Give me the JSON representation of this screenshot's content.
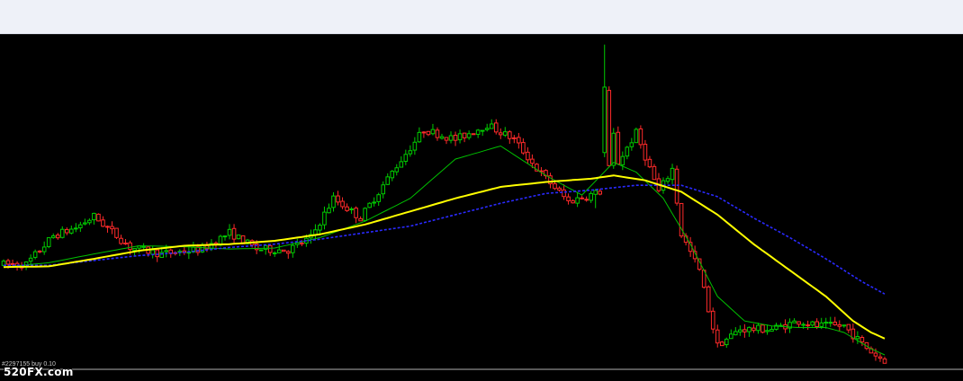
{
  "chart_data": {
    "type": "candlestick",
    "bar_count": 196,
    "y_range": [
      0,
      100
    ],
    "grid": false,
    "colors": {
      "background": "#000000",
      "top_bar": "#eef1f8",
      "bull_candle": "#00cc00",
      "bear_candle": "#ff2a2a",
      "ma_fast": "#00c000",
      "ma_medium": "#ffff00",
      "ma_slow": "#2a2aff",
      "baseline": "#b0b0b0"
    },
    "bear_anchors": [
      [
        0,
        31.8
      ],
      [
        5,
        31.8
      ],
      [
        11,
        40.5
      ],
      [
        16,
        43.0
      ],
      [
        20,
        46.5
      ],
      [
        28,
        37.0
      ],
      [
        35,
        35.0
      ],
      [
        44,
        36.5
      ],
      [
        50,
        41.5
      ],
      [
        56,
        36.5
      ],
      [
        63,
        36.2
      ],
      [
        68,
        40.0
      ],
      [
        73,
        52.0
      ],
      [
        79,
        46.0
      ],
      [
        87,
        62.0
      ],
      [
        93,
        73.0
      ],
      [
        100,
        70.0
      ],
      [
        107,
        74.5
      ],
      [
        113,
        70.0
      ],
      [
        118,
        61.0
      ],
      [
        125,
        51.0
      ],
      [
        132,
        54.0
      ],
      [
        133,
        88.0
      ],
      [
        136,
        63.0
      ],
      [
        140,
        72.0
      ],
      [
        145,
        54.0
      ],
      [
        148,
        61.0
      ],
      [
        150,
        41.0
      ],
      [
        154,
        30.0
      ],
      [
        156,
        18.0
      ],
      [
        158,
        7.0
      ],
      [
        163,
        12.0
      ],
      [
        170,
        12.0
      ],
      [
        176,
        14.5
      ],
      [
        180,
        13.0
      ],
      [
        186,
        13.0
      ],
      [
        190,
        7.5
      ],
      [
        193,
        4.0
      ],
      [
        195,
        2.5
      ]
    ],
    "ma_fast": [
      [
        0,
        31.0
      ],
      [
        10,
        32.3
      ],
      [
        20,
        35.0
      ],
      [
        30,
        37.5
      ],
      [
        40,
        37.2
      ],
      [
        50,
        36.5
      ],
      [
        60,
        36.8
      ],
      [
        70,
        40.0
      ],
      [
        80,
        45.0
      ],
      [
        90,
        52.0
      ],
      [
        100,
        64.0
      ],
      [
        110,
        68.0
      ],
      [
        120,
        59.0
      ],
      [
        128,
        53.0
      ],
      [
        135,
        63.0
      ],
      [
        140,
        60.0
      ],
      [
        146,
        52.0
      ],
      [
        152,
        38.0
      ],
      [
        158,
        22.0
      ],
      [
        164,
        14.5
      ],
      [
        170,
        13.0
      ],
      [
        176,
        12.5
      ],
      [
        182,
        12.5
      ],
      [
        186,
        11.0
      ],
      [
        192,
        6.0
      ],
      [
        196,
        3.5
      ]
    ],
    "ma_medium": [
      [
        0,
        31.0
      ],
      [
        10,
        31.2
      ],
      [
        20,
        33.5
      ],
      [
        30,
        36.0
      ],
      [
        40,
        37.5
      ],
      [
        50,
        38.0
      ],
      [
        60,
        39.0
      ],
      [
        70,
        41.0
      ],
      [
        80,
        44.0
      ],
      [
        90,
        48.0
      ],
      [
        100,
        52.0
      ],
      [
        110,
        55.5
      ],
      [
        120,
        57.0
      ],
      [
        130,
        58.0
      ],
      [
        135,
        59.0
      ],
      [
        142,
        57.5
      ],
      [
        150,
        54.0
      ],
      [
        158,
        47.0
      ],
      [
        166,
        38.0
      ],
      [
        174,
        30.0
      ],
      [
        182,
        22.0
      ],
      [
        188,
        14.5
      ],
      [
        192,
        11.0
      ],
      [
        196,
        8.5
      ]
    ],
    "ma_slow": [
      [
        0,
        31.5
      ],
      [
        10,
        31.5
      ],
      [
        20,
        33.0
      ],
      [
        30,
        34.5
      ],
      [
        40,
        35.5
      ],
      [
        50,
        37.0
      ],
      [
        60,
        38.0
      ],
      [
        70,
        39.5
      ],
      [
        80,
        41.5
      ],
      [
        90,
        43.5
      ],
      [
        100,
        47.0
      ],
      [
        110,
        50.5
      ],
      [
        120,
        53.5
      ],
      [
        130,
        54.5
      ],
      [
        140,
        56.0
      ],
      [
        150,
        56.0
      ],
      [
        158,
        52.5
      ],
      [
        166,
        46.0
      ],
      [
        174,
        40.0
      ],
      [
        182,
        33.5
      ],
      [
        190,
        26.5
      ],
      [
        196,
        22.0
      ]
    ],
    "baseline_level": 0
  },
  "status_text": "#2297155 buy 0.10",
  "watermark_text": "520FX.com"
}
